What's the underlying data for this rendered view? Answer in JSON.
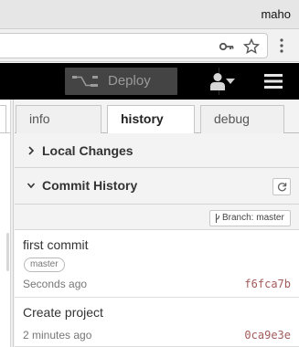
{
  "os": {
    "user": "maho"
  },
  "browser": {
    "icons": [
      "key-icon",
      "star-icon",
      "browser-menu-icon"
    ]
  },
  "header": {
    "deploy_label": "Deploy",
    "icons": [
      "deploy-icon",
      "caret-down-icon",
      "user-icon",
      "hamburger-icon"
    ],
    "background": "#000000"
  },
  "sidebar": {
    "tabs": [
      {
        "label": "info"
      },
      {
        "label": "history",
        "active": true
      },
      {
        "label": "debug"
      }
    ],
    "sections": {
      "local_changes": {
        "title": "Local Changes",
        "expanded": false
      },
      "commit_history": {
        "title": "Commit History",
        "expanded": true
      }
    },
    "branch_button": "Branch: master",
    "commits": [
      {
        "message": "first commit",
        "tag": "master",
        "time": "Seconds ago",
        "sha": "f6fca7b"
      },
      {
        "message": "Create project",
        "time": "2 minutes ago",
        "sha": "0ca9e3e"
      }
    ]
  },
  "colors": {
    "sha": "#a25b5b",
    "deploy_bg": "#444444",
    "active_tab_bg": "#ffffff"
  }
}
